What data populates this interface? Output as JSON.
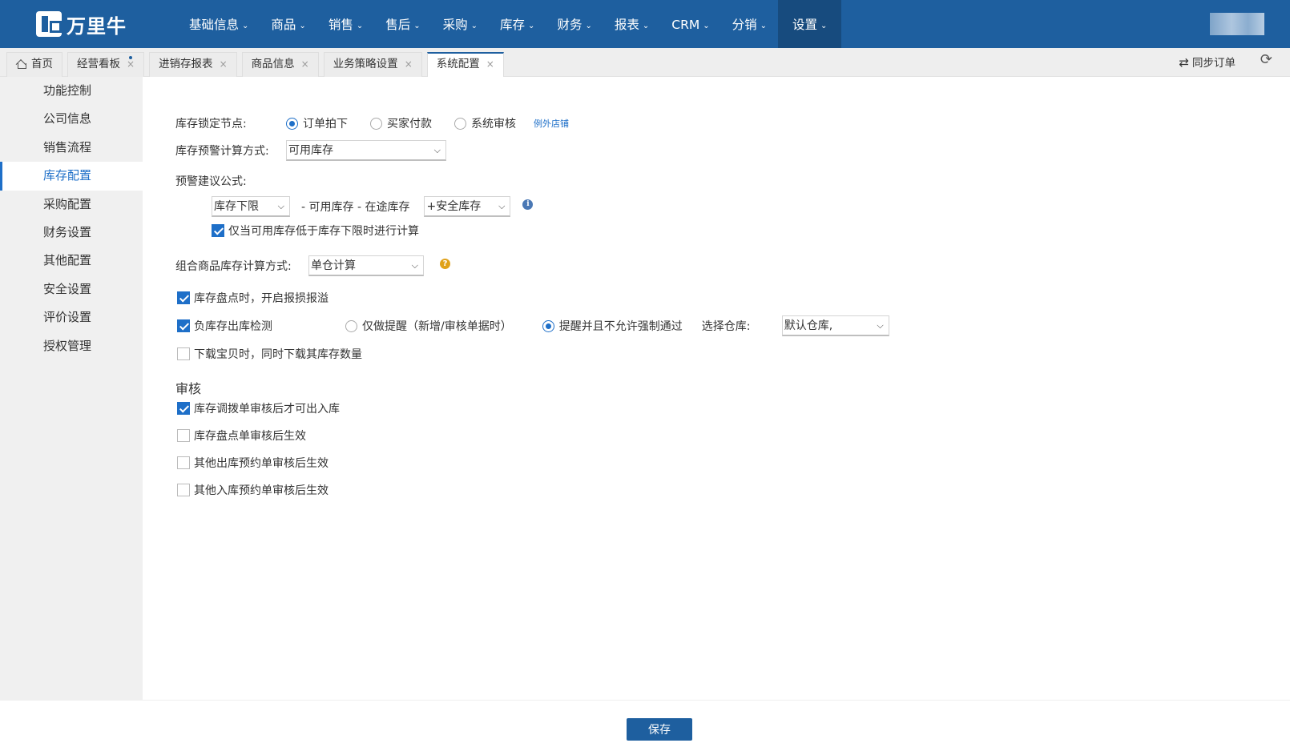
{
  "brand": {
    "logo_text": "万里牛"
  },
  "topnav": {
    "items": [
      {
        "label": "基础信息"
      },
      {
        "label": "商品"
      },
      {
        "label": "销售"
      },
      {
        "label": "售后"
      },
      {
        "label": "采购"
      },
      {
        "label": "库存"
      },
      {
        "label": "财务"
      },
      {
        "label": "报表"
      },
      {
        "label": "CRM"
      },
      {
        "label": "分销"
      },
      {
        "label": "设置"
      }
    ],
    "active": "设置",
    "caret": "⌄"
  },
  "tabs": [
    {
      "label": "首页",
      "closable": false
    },
    {
      "label": "经营看板",
      "closable": true
    },
    {
      "label": "进销存报表",
      "closable": true
    },
    {
      "label": "商品信息",
      "closable": true
    },
    {
      "label": "业务策略设置",
      "closable": true
    },
    {
      "label": "系统配置",
      "closable": true,
      "active": true
    }
  ],
  "tab_close_glyph": "×",
  "toolbar": {
    "sync_label": "同步订单",
    "sync_icon": "⇄",
    "refresh_icon": "⟳"
  },
  "sidebar": {
    "items": [
      {
        "label": "功能控制"
      },
      {
        "label": "公司信息"
      },
      {
        "label": "销售流程"
      },
      {
        "label": "库存配置",
        "active": true
      },
      {
        "label": "采购配置"
      },
      {
        "label": "财务设置"
      },
      {
        "label": "其他配置"
      },
      {
        "label": "安全设置"
      },
      {
        "label": "评价设置"
      },
      {
        "label": "授权管理"
      }
    ]
  },
  "form": {
    "lock_node": {
      "label": "库存锁定节点:",
      "options": [
        "订单拍下",
        "买家付款",
        "系统审核"
      ],
      "selected": "订单拍下",
      "exception_link": "例外店铺"
    },
    "warn_calc": {
      "label": "库存预警计算方式:",
      "value": "可用库存"
    },
    "formula": {
      "label": "预警建议公式:",
      "left_select": "库存下限",
      "middle_text": "- 可用库存 - 在途库存",
      "right_select": "+安全库存",
      "info_glyph": "i",
      "only_when_label": "仅当可用库存低于库存下限时进行计算",
      "only_when_checked": true
    },
    "combo_calc": {
      "label": "组合商品库存计算方式:",
      "value": "单仓计算",
      "help_glyph": "?"
    },
    "stocktake_overflow": {
      "label": "库存盘点时，开启报损报溢",
      "checked": true
    },
    "negative_check": {
      "label": "负库存出库检测",
      "checked": true,
      "options": [
        "仅做提醒（新增/审核单据时）",
        "提醒并且不允许强制通过"
      ],
      "selected": "提醒并且不允许强制通过",
      "warehouse_label": "选择仓库:",
      "warehouse_value": "默认仓库,"
    },
    "download_with_stock": {
      "label": "下载宝贝时，同时下载其库存数量",
      "checked": false
    }
  },
  "audit": {
    "title": "审核",
    "items": [
      {
        "label": "库存调拨单审核后才可出入库",
        "checked": true
      },
      {
        "label": "库存盘点单审核后生效",
        "checked": false
      },
      {
        "label": "其他出库预约单审核后生效",
        "checked": false
      },
      {
        "label": "其他入库预约单审核后生效",
        "checked": false
      }
    ]
  },
  "footer": {
    "save_label": "保存"
  },
  "colors": {
    "nav_bg": "#1e5f9f",
    "accent": "#1e6fc8",
    "help": "#e0a21a"
  }
}
